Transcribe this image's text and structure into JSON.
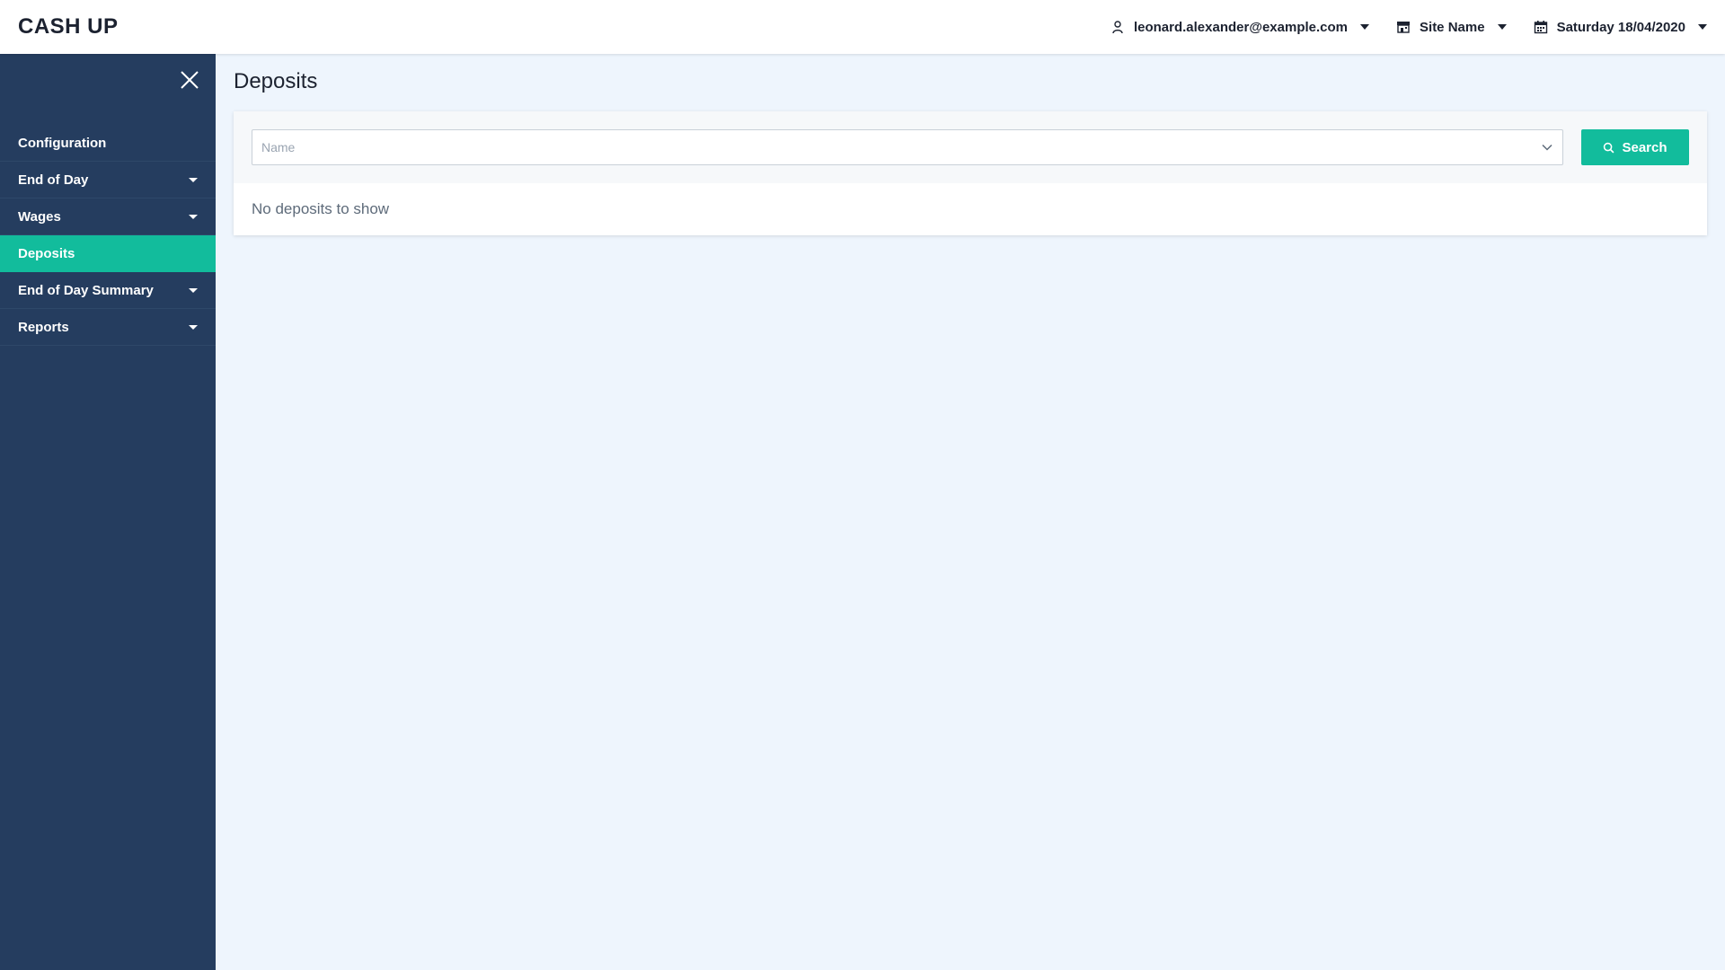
{
  "app": {
    "title": "CASH UP"
  },
  "header": {
    "user_email": "leonard.alexander@example.com",
    "site_name": "Site Name",
    "date": "Saturday 18/04/2020"
  },
  "sidebar": {
    "items": [
      {
        "label": "Configuration",
        "has_submenu": false,
        "active": false
      },
      {
        "label": "End of Day",
        "has_submenu": true,
        "active": false
      },
      {
        "label": "Wages",
        "has_submenu": true,
        "active": false
      },
      {
        "label": "Deposits",
        "has_submenu": false,
        "active": true
      },
      {
        "label": "End of Day Summary",
        "has_submenu": true,
        "active": false
      },
      {
        "label": "Reports",
        "has_submenu": true,
        "active": false
      }
    ]
  },
  "main": {
    "page_title": "Deposits",
    "filter": {
      "name_placeholder": "Name",
      "search_label": "Search"
    },
    "empty_message": "No deposits to show"
  },
  "colors": {
    "sidebar_bg": "#253d5f",
    "accent": "#12bc9c",
    "page_bg": "#eef5fd"
  }
}
